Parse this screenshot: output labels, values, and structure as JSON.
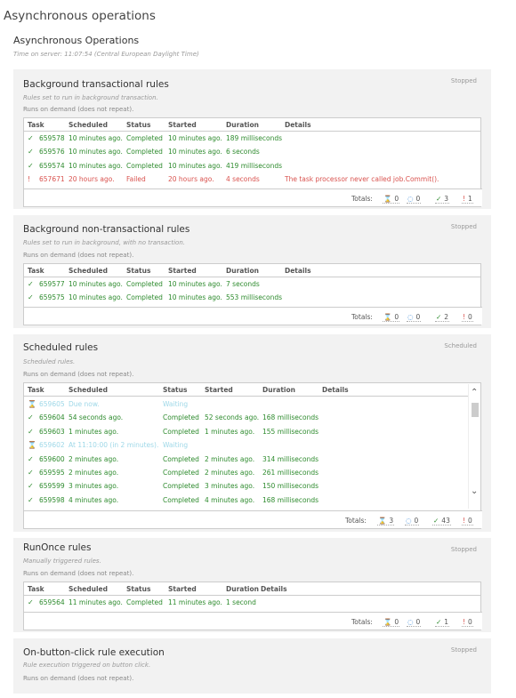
{
  "page": {
    "title": "Asynchronous operations",
    "subtitle": "Asynchronous Operations",
    "server_time": "Time on server: 11:07:54 (Central European Daylight Time)"
  },
  "icons": {
    "completed": "✓",
    "failed": "!",
    "waiting": "⌛",
    "running": "◌",
    "scroll_up": "⌃",
    "scroll_down": "⌄"
  },
  "colors": {
    "completed": "#2e8b2e",
    "failed": "#d9534f",
    "waiting": "#9fd8e8",
    "running": "#2a7fd4"
  },
  "columns": {
    "task": "Task",
    "scheduled": "Scheduled",
    "status": "Status",
    "started": "Started",
    "duration": "Duration",
    "details": "Details"
  },
  "totals_label": "Totals:",
  "sections": [
    {
      "title": "Background transactional rules",
      "state": "Stopped",
      "description": "Rules set to run in background transaction.",
      "runs": "Runs on demand (does not repeat).",
      "rows": [
        {
          "status_type": "ok",
          "task": "659578",
          "scheduled": "10 minutes ago.",
          "status": "Completed",
          "started": "10 minutes ago.",
          "duration": "189 milliseconds",
          "details": ""
        },
        {
          "status_type": "ok",
          "task": "659576",
          "scheduled": "10 minutes ago.",
          "status": "Completed",
          "started": "10 minutes ago.",
          "duration": "6 seconds",
          "details": ""
        },
        {
          "status_type": "ok",
          "task": "659574",
          "scheduled": "10 minutes ago.",
          "status": "Completed",
          "started": "10 minutes ago.",
          "duration": "419 milliseconds",
          "details": ""
        },
        {
          "status_type": "fail",
          "task": "657671",
          "scheduled": "20 hours ago.",
          "status": "Failed",
          "started": "20 hours ago.",
          "duration": "4 seconds",
          "details": "The task processor never called job.Commit()."
        }
      ],
      "totals": {
        "waiting": "0",
        "running": "0",
        "completed": "3",
        "failed": "1"
      }
    },
    {
      "title": "Background non-transactional rules",
      "state": "Stopped",
      "description": "Rules set to run in background, with no transaction.",
      "runs": "Runs on demand (does not repeat).",
      "rows": [
        {
          "status_type": "ok",
          "task": "659577",
          "scheduled": "10 minutes ago.",
          "status": "Completed",
          "started": "10 minutes ago.",
          "duration": "7 seconds",
          "details": ""
        },
        {
          "status_type": "ok",
          "task": "659575",
          "scheduled": "10 minutes ago.",
          "status": "Completed",
          "started": "10 minutes ago.",
          "duration": "553 milliseconds",
          "details": ""
        }
      ],
      "totals": {
        "waiting": "0",
        "running": "0",
        "completed": "2",
        "failed": "0"
      }
    },
    {
      "title": "Scheduled rules",
      "state": "Scheduled",
      "description": "Scheduled rules.",
      "runs": "Runs on demand (does not repeat).",
      "rows": [
        {
          "status_type": "wait",
          "task": "659605",
          "scheduled": "Due now.",
          "status": "Waiting",
          "started": "",
          "duration": "",
          "details": ""
        },
        {
          "status_type": "ok",
          "task": "659604",
          "scheduled": "54 seconds ago.",
          "status": "Completed",
          "started": "52 seconds ago.",
          "duration": "168 milliseconds",
          "details": ""
        },
        {
          "status_type": "ok",
          "task": "659603",
          "scheduled": "1 minutes ago.",
          "status": "Completed",
          "started": "1 minutes ago.",
          "duration": "155 milliseconds",
          "details": ""
        },
        {
          "status_type": "wait",
          "task": "659602",
          "scheduled": "At 11:10:00 (in 2 minutes).",
          "status": "Waiting",
          "started": "",
          "duration": "",
          "details": ""
        },
        {
          "status_type": "ok",
          "task": "659600",
          "scheduled": "2 minutes ago.",
          "status": "Completed",
          "started": "2 minutes ago.",
          "duration": "314 milliseconds",
          "details": ""
        },
        {
          "status_type": "ok",
          "task": "659595",
          "scheduled": "2 minutes ago.",
          "status": "Completed",
          "started": "2 minutes ago.",
          "duration": "261 milliseconds",
          "details": ""
        },
        {
          "status_type": "ok",
          "task": "659599",
          "scheduled": "3 minutes ago.",
          "status": "Completed",
          "started": "3 minutes ago.",
          "duration": "150 milliseconds",
          "details": ""
        },
        {
          "status_type": "ok",
          "task": "659598",
          "scheduled": "4 minutes ago.",
          "status": "Completed",
          "started": "4 minutes ago.",
          "duration": "168 milliseconds",
          "details": ""
        }
      ],
      "totals": {
        "waiting": "3",
        "running": "0",
        "completed": "43",
        "failed": "0"
      }
    },
    {
      "title": "RunOnce rules",
      "state": "Stopped",
      "description": "Manually triggered rules.",
      "runs": "Runs on demand (does not repeat).",
      "rows": [
        {
          "status_type": "ok",
          "task": "659564",
          "scheduled": "11 minutes ago.",
          "status": "Completed",
          "started": "11 minutes ago.",
          "duration": "1 second",
          "details": ""
        }
      ],
      "totals": {
        "waiting": "0",
        "running": "0",
        "completed": "1",
        "failed": "0"
      }
    },
    {
      "title": "On-button-click rule execution",
      "state": "Stopped",
      "description": "Rule execution triggered on button click.",
      "runs": "Runs on demand (does not repeat).",
      "rows": [],
      "totals": null
    }
  ]
}
